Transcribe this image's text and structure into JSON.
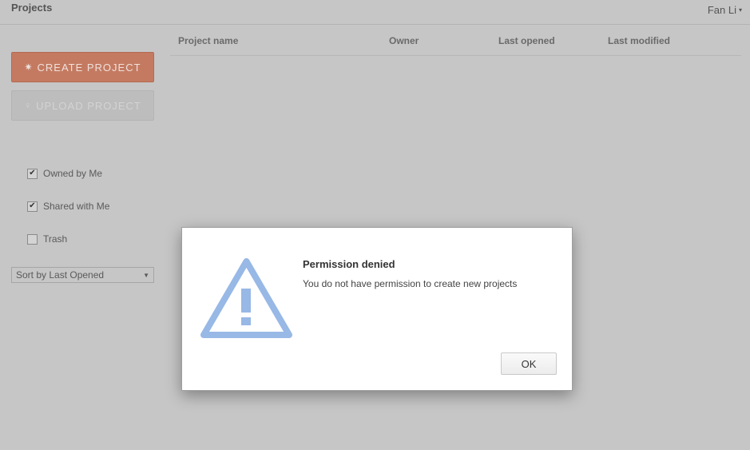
{
  "header": {
    "title": "Projects",
    "user_name": "Fan Li",
    "user_caret": "▾"
  },
  "sidebar": {
    "create_button": {
      "icon": "✷",
      "label": "CREATE PROJECT"
    },
    "upload_button": {
      "icon": "♀",
      "label": "UPLOAD PROJECT"
    },
    "filters": [
      {
        "label": "Owned by Me",
        "checked": true,
        "mark": "✔"
      },
      {
        "label": "Shared with Me",
        "checked": true,
        "mark": "✔"
      },
      {
        "label": "Trash",
        "checked": false,
        "mark": ""
      }
    ],
    "sort": {
      "selected": "Sort by Last Opened",
      "arrow": "▼"
    }
  },
  "table": {
    "columns": [
      "Project name",
      "Owner",
      "Last opened",
      "Last modified"
    ]
  },
  "dialog": {
    "title": "Permission denied",
    "message": "You do not have permission to create new projects",
    "ok_label": "OK",
    "icon": "warning-triangle-icon",
    "icon_color": "#98b8e6"
  },
  "colors": {
    "accent": "#c47a61",
    "overlay_bg": "#c6c6c6"
  }
}
